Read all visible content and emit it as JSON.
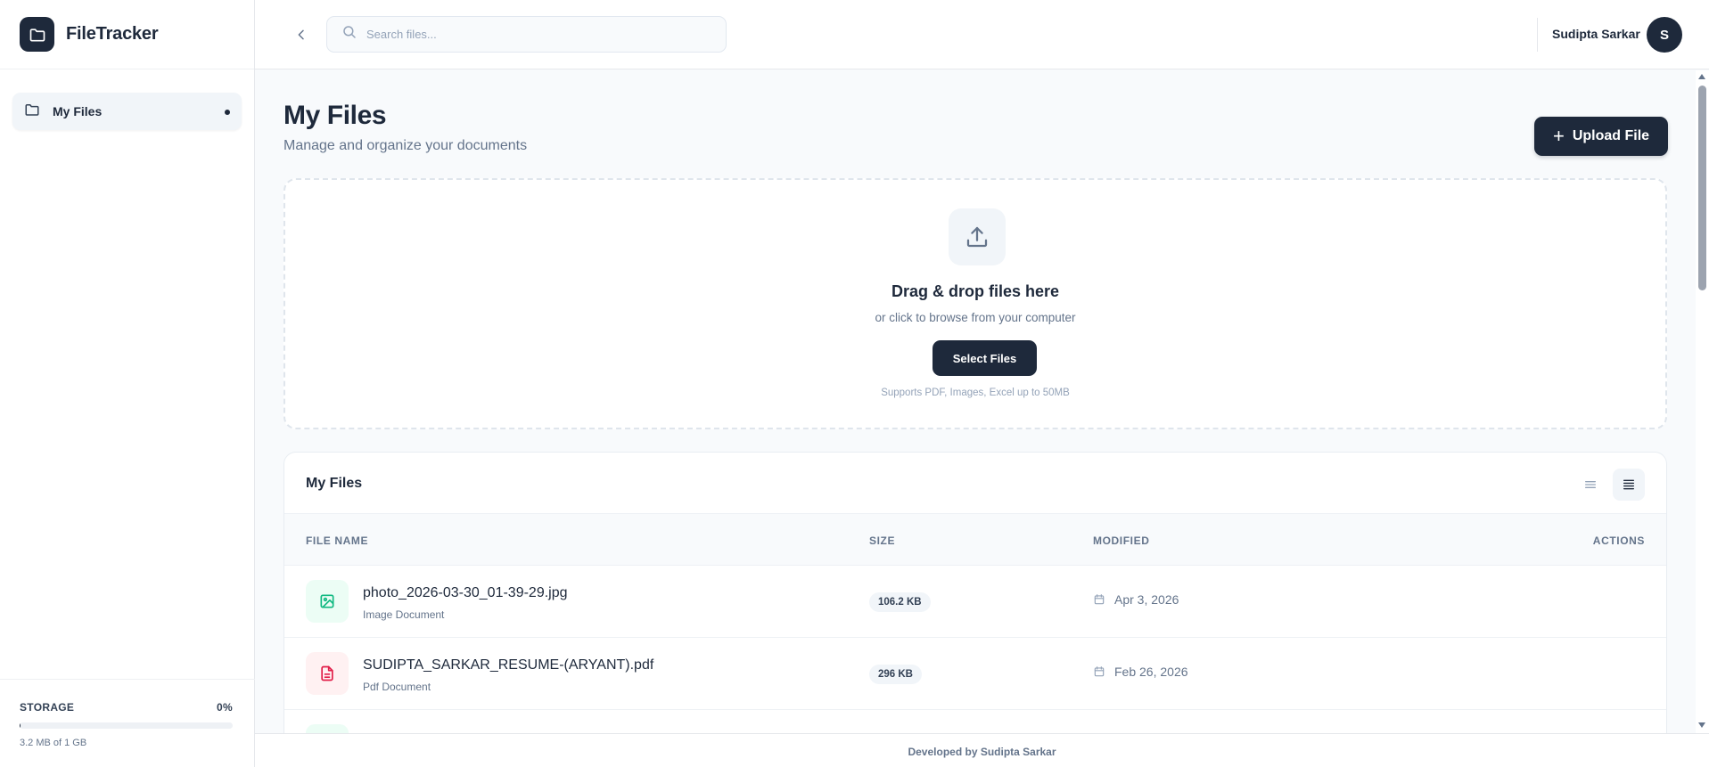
{
  "app": {
    "name": "FileTracker"
  },
  "sidebar": {
    "items": [
      {
        "label": "My Files",
        "active": true
      }
    ],
    "storage": {
      "label": "STORAGE",
      "percent": "0%",
      "usage": "3.2 MB of 1 GB",
      "fill_fraction": 0.003
    }
  },
  "header": {
    "search_placeholder": "Search files...",
    "user_name": "Sudipta Sarkar",
    "avatar_initial": "S"
  },
  "main": {
    "title": "My Files",
    "subtitle": "Manage and organize your documents",
    "upload_label": "Upload File",
    "dropzone": {
      "title": "Drag & drop files here",
      "subtitle": "or click to browse from your computer",
      "button_label": "Select Files",
      "note": "Supports PDF, Images, Excel up to 50MB"
    },
    "files_card": {
      "title": "My Files",
      "columns": [
        "FILE NAME",
        "SIZE",
        "MODIFIED",
        "ACTIONS"
      ],
      "rows": [
        {
          "name": "photo_2026-03-30_01-39-29.jpg",
          "type": "Image Document",
          "size": "106.2 KB",
          "modified": "Apr 3, 2026",
          "icon": "image-icon"
        },
        {
          "name": "SUDIPTA_SARKAR_RESUME-(ARYANT).pdf",
          "type": "Pdf Document",
          "size": "296 KB",
          "modified": "Feb 26, 2026",
          "icon": "pdf-document-icon"
        }
      ]
    }
  },
  "footer": {
    "text": "Developed by Sudipta Sarkar"
  },
  "colors": {
    "primary": "#1e293b",
    "image_icon": "#10b981",
    "pdf_icon": "#e11d48"
  }
}
